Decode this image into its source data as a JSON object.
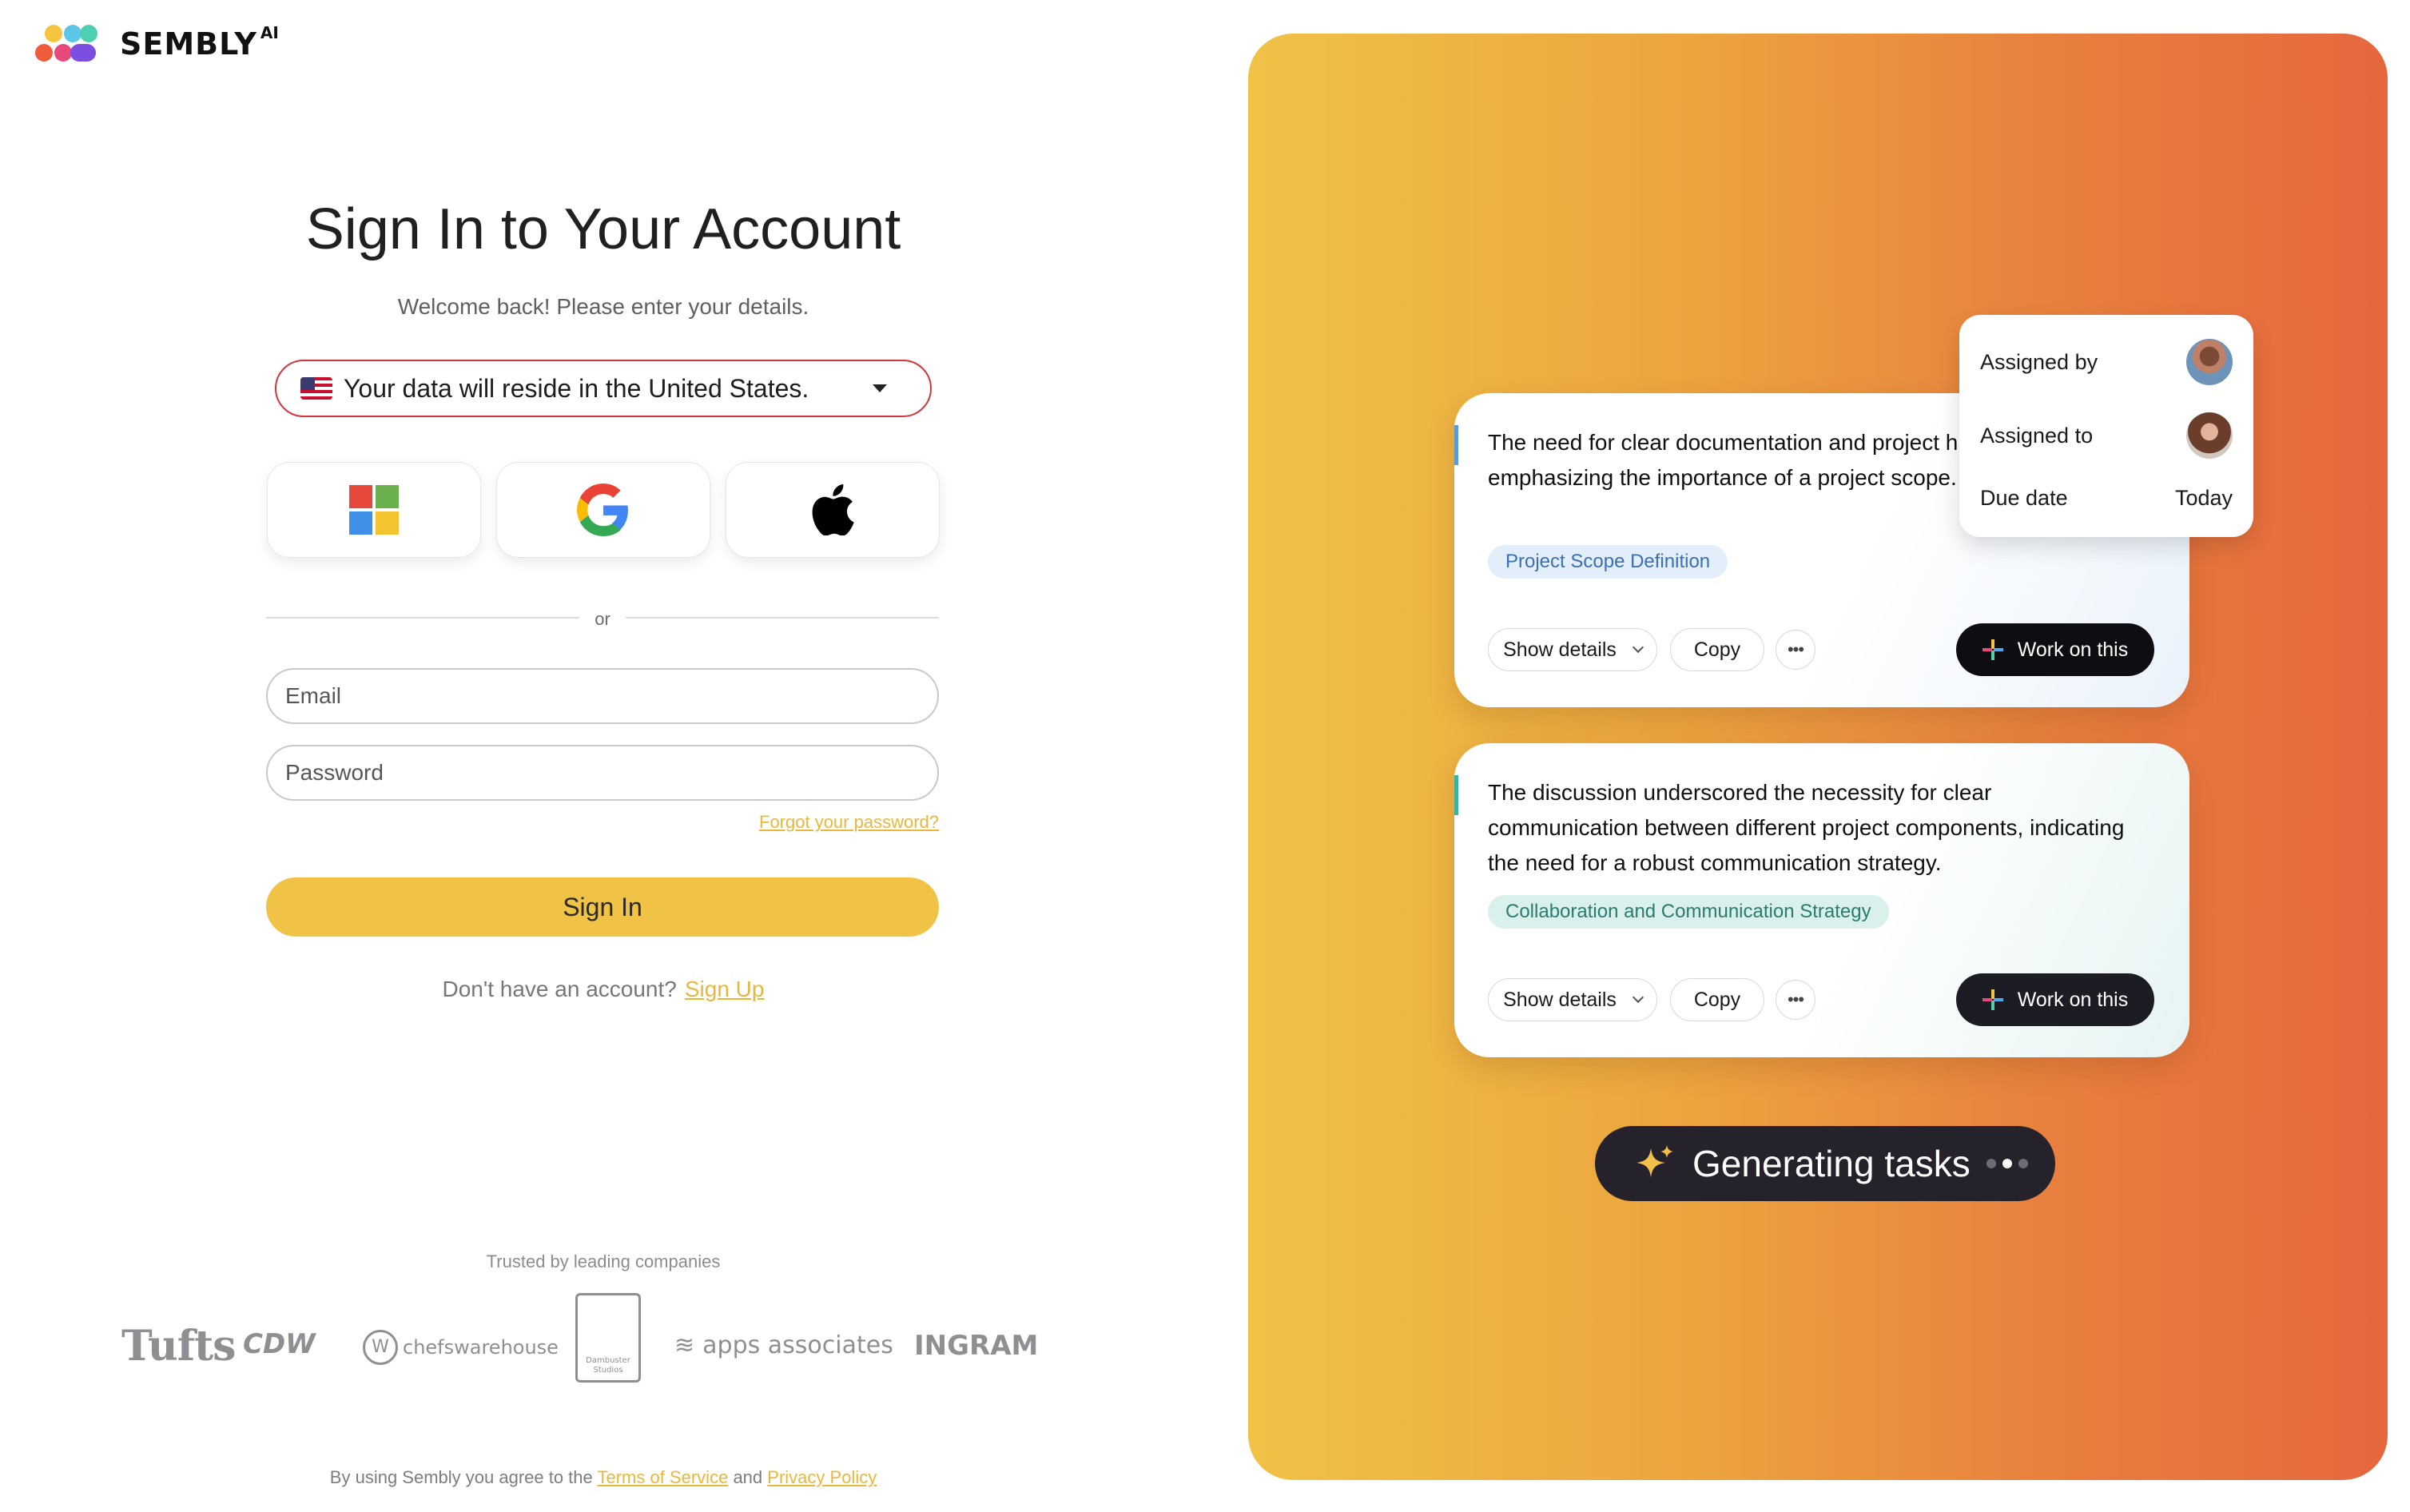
{
  "brand": {
    "name": "SEMBLY",
    "suffix": "AI"
  },
  "login": {
    "title": "Sign In to Your Account",
    "subtitle": "Welcome back! Please enter your details.",
    "region_text": "Your data will reside in the United States.",
    "sso": [
      "microsoft-icon",
      "google-icon",
      "apple-icon"
    ],
    "divider_text": "or",
    "email_placeholder": "Email",
    "password_placeholder": "Password",
    "forgot_label": "Forgot your password?",
    "signin_label": "Sign In",
    "signup_prompt": "Don't have an account?",
    "signup_label": "Sign Up"
  },
  "trusted": {
    "heading": "Trusted by leading companies",
    "logos": [
      "Tufts",
      "CDW",
      "chefswarehouse",
      "Dambuster Studios",
      "apps associates",
      "INGRAM"
    ]
  },
  "footer": {
    "prefix": "By using Sembly you agree to the",
    "terms": "Terms of Service",
    "and": "and",
    "privacy": "Privacy Policy"
  },
  "hero": {
    "cards": [
      {
        "text": "The need for clear documentation and project highlighted, emphasizing the importance of a project scope.",
        "tag": "Project Scope Definition",
        "details": "Show details",
        "copy": "Copy",
        "work": "Work on this"
      },
      {
        "text": "The discussion underscored the necessity for clear communication between different project components, indicating the need for a robust communication strategy.",
        "tag": "Collaboration and Communication Strategy",
        "details": "Show details",
        "copy": "Copy",
        "work": "Work on this"
      }
    ],
    "assign": {
      "assigned_by": "Assigned by",
      "assigned_to": "Assigned to",
      "due_label": "Due date",
      "due_value": "Today"
    },
    "generating": "Generating tasks"
  },
  "colors": {
    "accent_yellow": "#f0c346",
    "link_yellow": "#e9b83b",
    "region_border": "#d1373d",
    "gradient_start": "#f0c246",
    "gradient_end": "#e5673d",
    "dark_button": "#0e0e12"
  }
}
